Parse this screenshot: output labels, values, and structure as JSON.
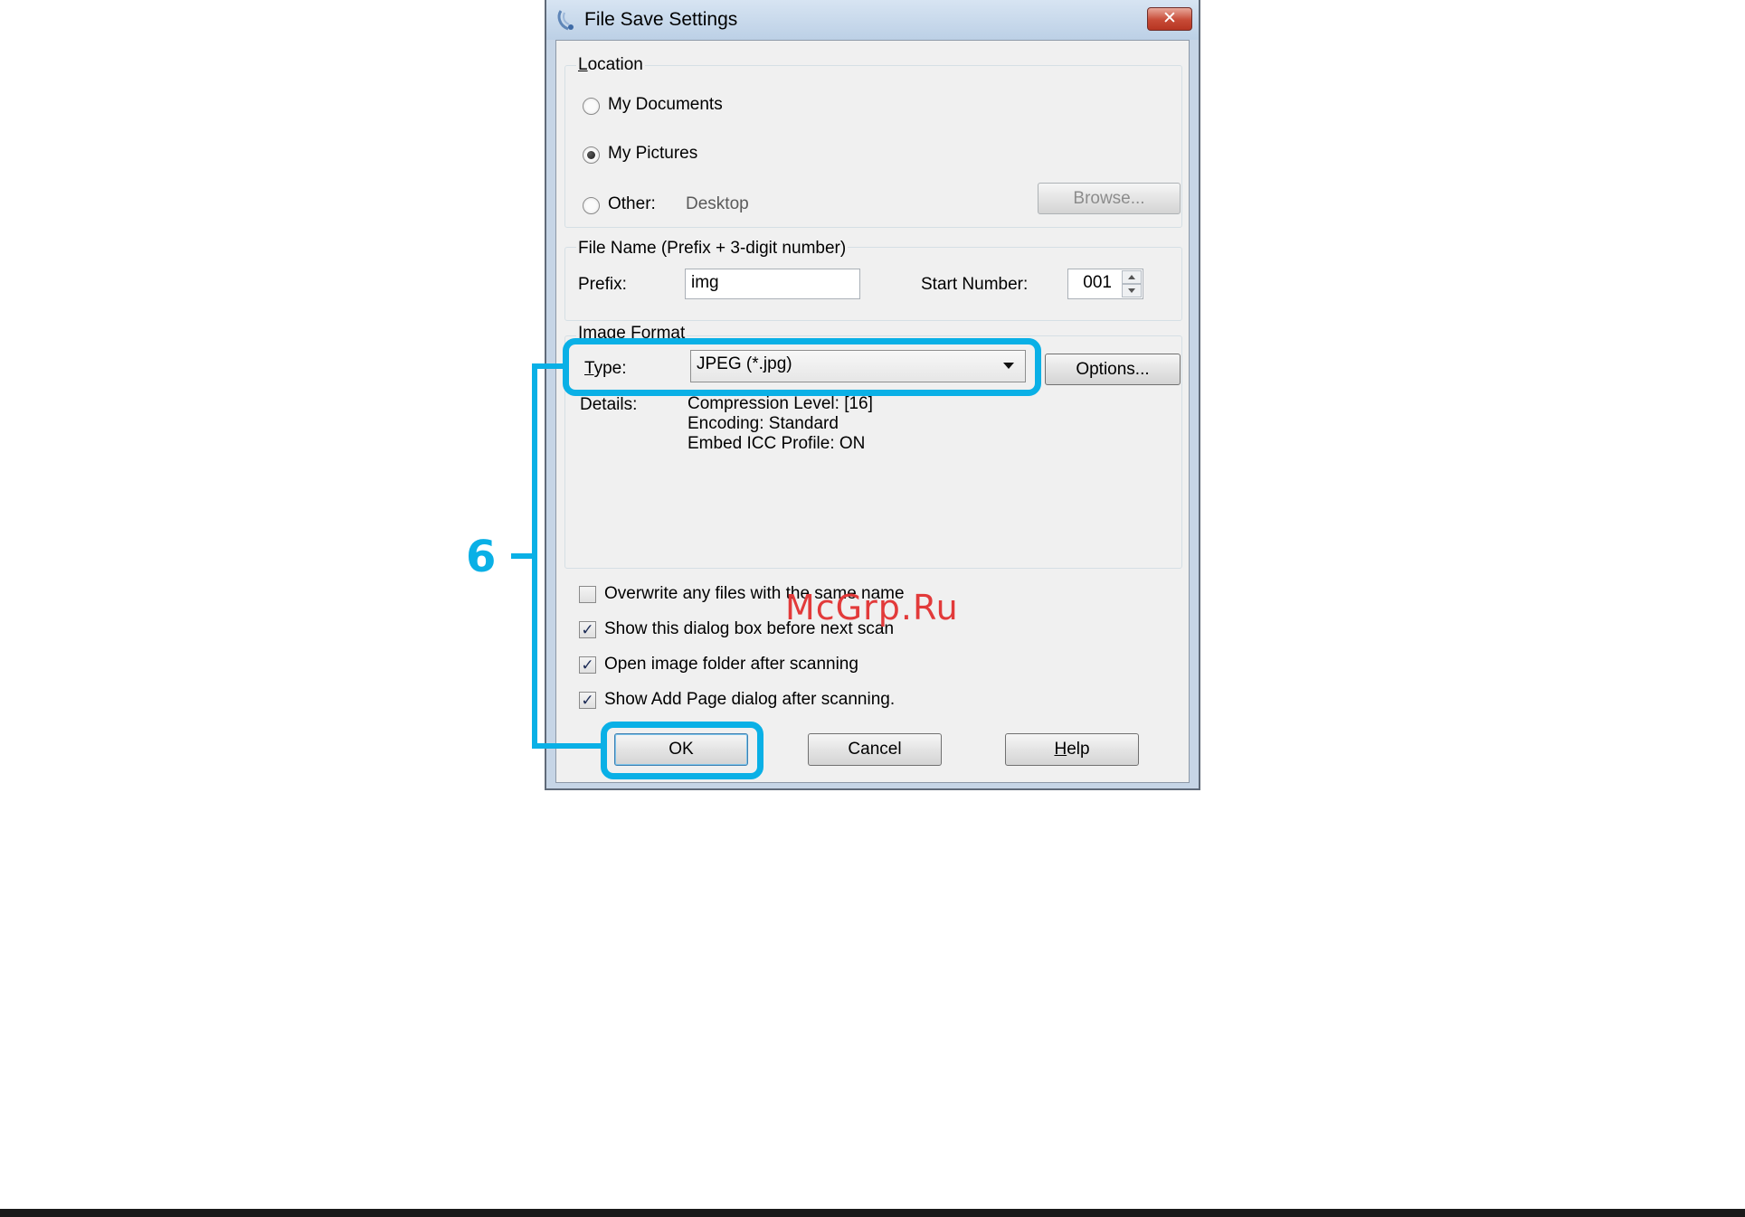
{
  "window": {
    "title": "File Save Settings",
    "close_glyph": "✕"
  },
  "location": {
    "group_label": "Location",
    "options": [
      {
        "label": "My Documents",
        "selected": false
      },
      {
        "label": "My Pictures",
        "selected": true
      },
      {
        "label": "Other:",
        "selected": false
      }
    ],
    "other_path": "Desktop",
    "browse_label": "Browse..."
  },
  "file_name": {
    "group_label": "File Name (Prefix + 3-digit number)",
    "prefix_label": "Prefix:",
    "prefix_value": "img",
    "start_number_label": "Start Number:",
    "start_number_value": "001"
  },
  "image_format": {
    "group_label": "Image Format",
    "type_label": "Type:",
    "type_value": "JPEG (*.jpg)",
    "options_label": "Options...",
    "details_label": "Details:",
    "details": [
      "Compression Level: [16]",
      "Encoding: Standard",
      "Embed ICC Profile: ON"
    ]
  },
  "checkboxes": [
    {
      "label": "Overwrite any files with the same name",
      "checked": false
    },
    {
      "label": "Show this dialog box before next scan",
      "checked": true
    },
    {
      "label": "Open image folder after scanning",
      "checked": true
    },
    {
      "label": "Show Add Page dialog after scanning.",
      "checked": true
    }
  ],
  "buttons": {
    "ok": "OK",
    "cancel": "Cancel",
    "help": "Help"
  },
  "annotation": {
    "step_number": "6",
    "highlight_color": "#0ab0e6"
  },
  "watermark": "McGrp.Ru"
}
